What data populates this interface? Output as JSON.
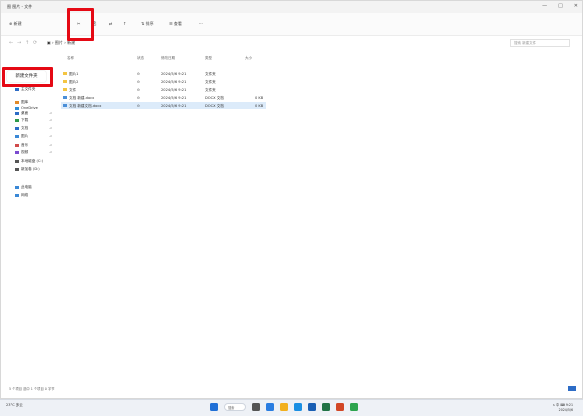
{
  "window": {
    "title": "图 图片 - 文件",
    "buttons": [
      "—",
      "□",
      "✕"
    ]
  },
  "toolbar": {
    "new_label": "⊕ 新建",
    "items": [
      "✂",
      "⎘",
      "⇄",
      "↑",
      "⇅ 排序",
      "☰ 查看",
      "···"
    ]
  },
  "address": {
    "nav": [
      "←",
      "→",
      "↑",
      "⟳"
    ],
    "breadcrumb": "▣ › 图片 › 新建",
    "search_placeholder": "搜索 新建文件"
  },
  "sidebar": {
    "new_button": "新建文件夹",
    "items": [
      {
        "label": "主文件夹",
        "color": "#2d6cc6"
      },
      {
        "label": "图库",
        "color": "#e08a2a"
      },
      {
        "label": "OneDrive",
        "color": "#2f8dd8"
      },
      {
        "label": "桌面",
        "color": "#2d6cc6"
      },
      {
        "label": "下载",
        "color": "#2d9a4a"
      },
      {
        "label": "文档",
        "color": "#2d6cc6"
      },
      {
        "label": "图片",
        "color": "#3a88d6"
      },
      {
        "label": "音乐",
        "color": "#d04a4a"
      },
      {
        "label": "视频",
        "color": "#7a4ad0"
      },
      {
        "label": "本地磁盘 (C:)",
        "color": "#555555"
      },
      {
        "label": "新加卷 (D:)",
        "color": "#555555"
      },
      {
        "label": "此电脑",
        "color": "#3a88d6"
      },
      {
        "label": "网络",
        "color": "#3a88d6"
      }
    ]
  },
  "table": {
    "headers": [
      "名称",
      "状态",
      "修改日期",
      "类型",
      "大小"
    ],
    "rows": [
      {
        "name": "图片1",
        "status": "⊙",
        "date": "2024/5/6 9:21",
        "type": "文件夹",
        "size": "",
        "doc": false,
        "selected": false
      },
      {
        "name": "图片2",
        "status": "⊙",
        "date": "2024/5/6 9:21",
        "type": "文件夹",
        "size": "",
        "doc": false,
        "selected": false
      },
      {
        "name": "文件",
        "status": "⊙",
        "date": "2024/5/6 9:21",
        "type": "文件夹",
        "size": "",
        "doc": false,
        "selected": false
      },
      {
        "name": "文档 新建.docx",
        "status": "⊙",
        "date": "2024/5/6 9:21",
        "type": "DOCX 文档",
        "size": "0 KB",
        "doc": true,
        "selected": false
      },
      {
        "name": "文档 新建文档.docx",
        "status": "⊙",
        "date": "2024/5/6 9:21",
        "type": "DOCX 文档",
        "size": "0 KB",
        "doc": true,
        "selected": true
      }
    ]
  },
  "statusbar": "5 个项目    选中 1 个项目 0 字节    ",
  "taskbar": {
    "weather": "23°C\n多云",
    "search": "搜索",
    "time": "9:21",
    "date": "2024/5/6",
    "tray": "∧  中  ⌨"
  },
  "colors": {
    "highlight": "#e50914",
    "selected_row": "#dcebfa",
    "accent": "#2d6cc6"
  }
}
